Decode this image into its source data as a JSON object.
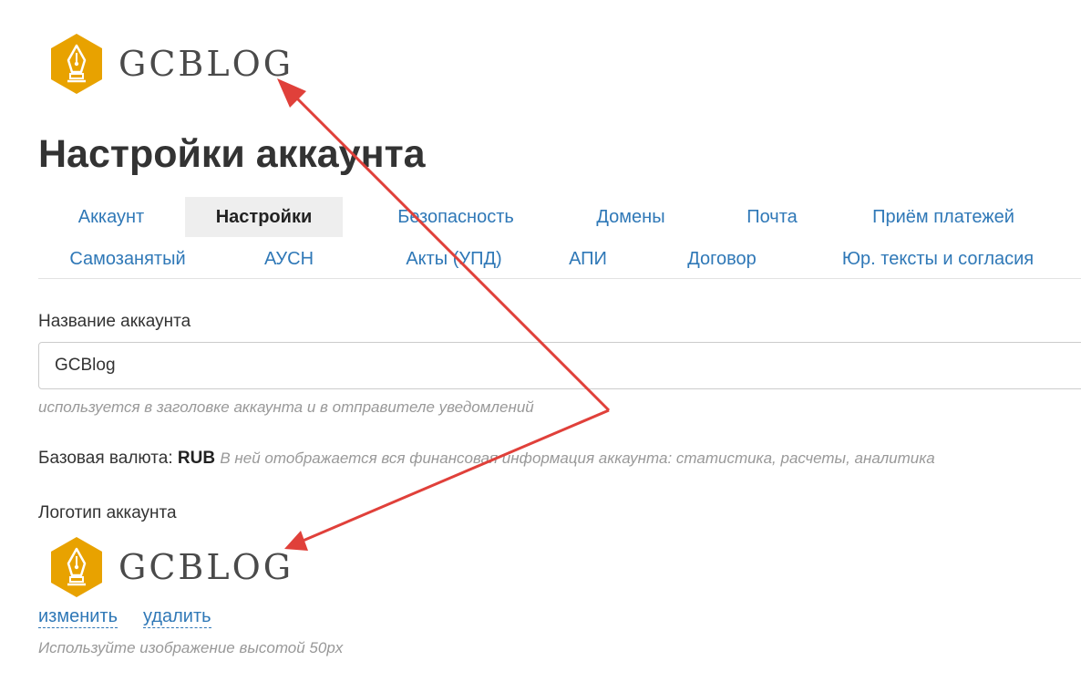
{
  "logo": {
    "text": "GCBLOG",
    "color": "#e8a200"
  },
  "page": {
    "title": "Настройки аккаунта"
  },
  "tabs": [
    {
      "label": "Аккаунт",
      "active": false
    },
    {
      "label": "Настройки",
      "active": true
    },
    {
      "label": "Безопасность",
      "active": false
    },
    {
      "label": "Домены",
      "active": false
    },
    {
      "label": "Почта",
      "active": false
    },
    {
      "label": "Приём платежей",
      "active": false
    },
    {
      "label": "Самозанятый",
      "active": false
    },
    {
      "label": "АУСН",
      "active": false
    },
    {
      "label": "Акты (УПД)",
      "active": false
    },
    {
      "label": "АПИ",
      "active": false
    },
    {
      "label": "Договор",
      "active": false
    },
    {
      "label": "Юр. тексты и согласия",
      "active": false
    }
  ],
  "account_name": {
    "label": "Название аккаунта",
    "value": "GCBlog",
    "hint": "используется в заголовке аккаунта и в отправителе уведомлений"
  },
  "currency": {
    "label": "Базовая валюта:",
    "code": "RUB",
    "description": "В ней отображается вся финансовая информация аккаунта: статистика, расчеты, аналитика"
  },
  "account_logo": {
    "label": "Логотип аккаунта",
    "change_label": "изменить",
    "delete_label": "удалить",
    "hint": "Используйте изображение высотой 50px"
  },
  "colors": {
    "link": "#2f78b7",
    "arrow": "#e0403a",
    "active_tab_bg": "#eeeeee"
  }
}
